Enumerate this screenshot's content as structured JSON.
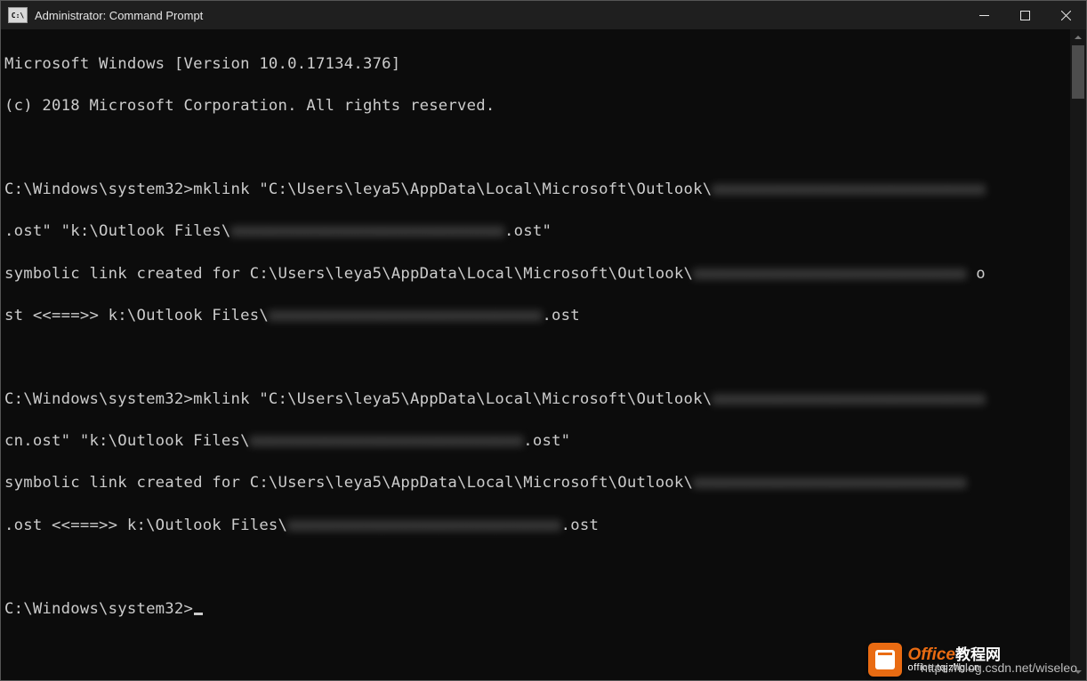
{
  "window": {
    "icon_label": "C:\\",
    "title": "Administrator: Command Prompt"
  },
  "terminal": {
    "header_line1": "Microsoft Windows [Version 10.0.17134.376]",
    "header_line2": "(c) 2018 Microsoft Corporation. All rights reserved.",
    "prompt": "C:\\Windows\\system32>",
    "cmd1_a": "mklink \"C:\\Users\\leya5\\AppData\\Local\\Microsoft\\Outlook\\",
    "cmd1_blur1": "xxxxxxxxxxxxxxxxxxxxxxxxxxxxx",
    "cmd1_b": ".ost\" \"k:\\Outlook Files\\",
    "cmd1_blur2": "xxxxxxxxxxxxxxxxxxxxxxxxxxxxx",
    "cmd1_c": ".ost\"",
    "res1_a": "symbolic link created for C:\\Users\\leya5\\AppData\\Local\\Microsoft\\Outlook\\",
    "res1_blur1": "xxxxxxxxxxxxxxxxxxxxxxxxxxxxx",
    "res1_b": " o",
    "res1_c": "st <<===>> k:\\Outlook Files\\",
    "res1_blur2": "xxxxxxxxxxxxxxxxxxxxxxxxxxxxx",
    "res1_d": ".ost",
    "cmd2_a": "mklink \"C:\\Users\\leya5\\AppData\\Local\\Microsoft\\Outlook\\",
    "cmd2_blur1": "xxxxxxxxxxxxxxxxxxxxxxxxxxxxx",
    "cmd2_a2": "",
    "cmd2_b": "cn.ost\" \"k:\\Outlook Files\\",
    "cmd2_blur2": "xxxxxxxxxxxxxxxxxxxxxxxxxxxxx",
    "cmd2_c": ".ost\"",
    "res2_a": "symbolic link created for C:\\Users\\leya5\\AppData\\Local\\Microsoft\\Outlook\\",
    "res2_blur1": "xxxxxxxxxxxxxxxxxxxxxxxxxxxxx",
    "res2_b": "",
    "res2_c": ".ost <<===>> k:\\Outlook Files\\",
    "res2_blur2": "xxxxxxxxxxxxxxxxxxxxxxxxxxxxx",
    "res2_d": ".ost"
  },
  "footer": {
    "url": "https://blog.csdn.net/wiseleo"
  },
  "watermark": {
    "brand": "Office",
    "brand_suffix": "教程网",
    "site": "office.tqjzhg.cn"
  }
}
